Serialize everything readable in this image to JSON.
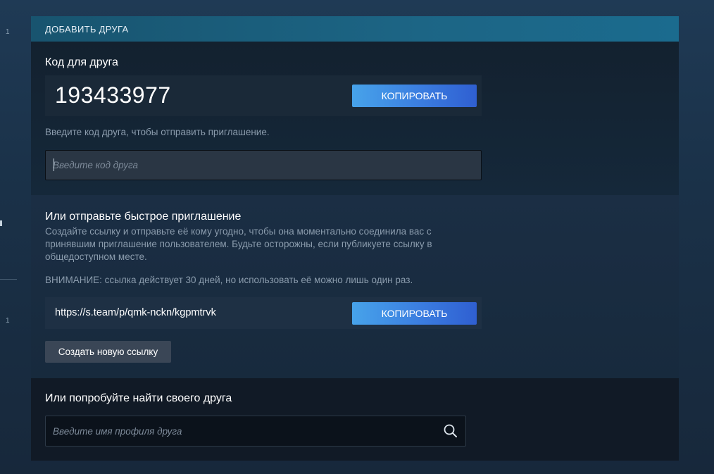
{
  "side": {
    "num_top": "1",
    "num_bottom": "1"
  },
  "header": {
    "title": "ДОБАВИТЬ ДРУГА"
  },
  "friend_code": {
    "title": "Код для друга",
    "code": "193433977",
    "copy_label": "КОПИРОВАТЬ",
    "hint": "Введите код друга, чтобы отправить приглашение.",
    "input_placeholder": "Введите код друга",
    "input_value": ""
  },
  "quick_invite": {
    "title": "Или отправьте быстрое приглашение",
    "description_line1": "Создайте ссылку и отправьте её кому угодно, чтобы она моментально соединила вас с",
    "description_line2": "принявшим приглашение пользователем. Будьте осторожны, если публикуете ссылку в",
    "description_line3": "общедоступном месте.",
    "warning": "ВНИМАНИЕ: ссылка действует 30 дней, но использовать её можно лишь один раз.",
    "link": "https://s.team/p/qmk-nckn/kgpmtrvk",
    "copy_label": "КОПИРОВАТЬ",
    "new_link_label": "Создать новую ссылку"
  },
  "search": {
    "title": "Или попробуйте найти своего друга",
    "placeholder": "Введите имя профиля друга",
    "value": "",
    "icon": "search-icon"
  },
  "colors": {
    "accent_button": "#3b7de0",
    "header_bar": "#1c6585",
    "panel_bg": "#172432"
  }
}
